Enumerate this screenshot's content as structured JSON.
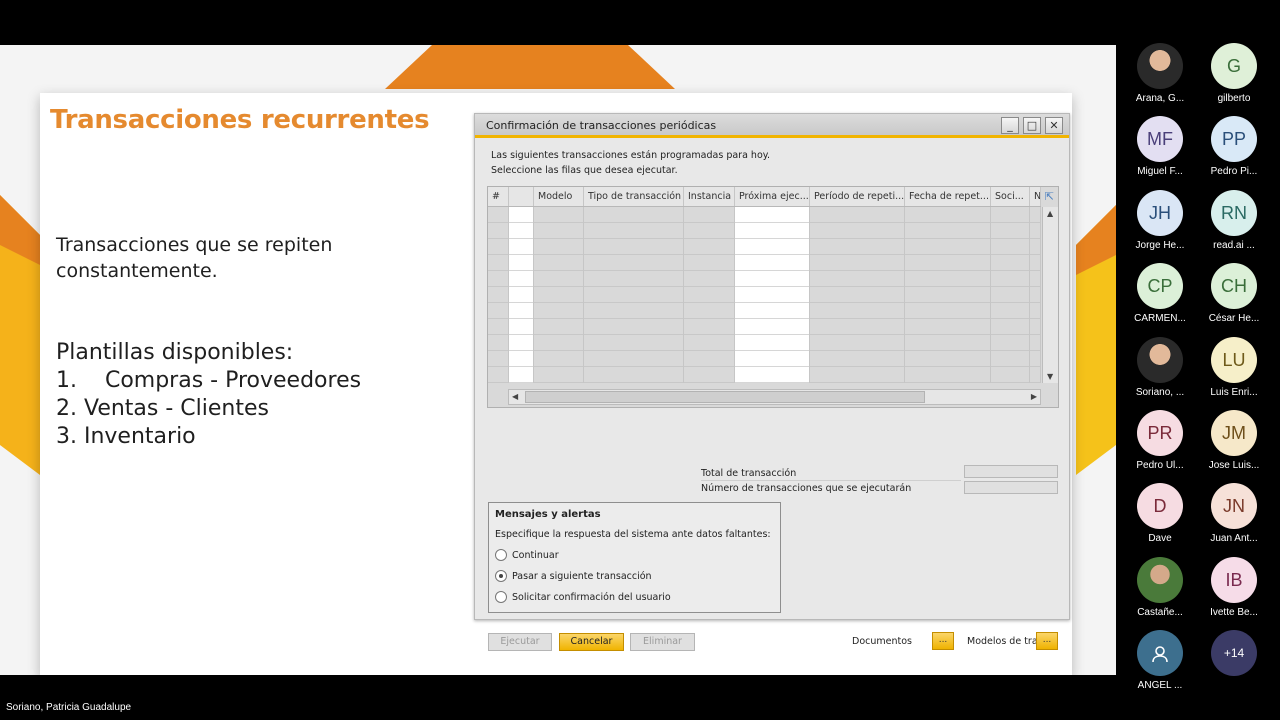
{
  "slide": {
    "title": "Transacciones recurrentes",
    "body1": "Transacciones que se repiten constantemente.",
    "templates_heading": "Plantillas disponibles:",
    "templates": [
      "1.    Compras - Proveedores",
      "2. Ventas - Clientes",
      "3. Inventario"
    ],
    "accent_color": "#e58a2f"
  },
  "dialog": {
    "title": "Confirmación de transacciones periódicas",
    "info_line1": "Las siguientes transacciones están programadas para hoy.",
    "info_line2": "Seleccione las filas que desea ejecutar.",
    "columns": [
      "#",
      "",
      "Modelo",
      "Tipo de transacción",
      "Instancia",
      "Próxima ejec...",
      "Período de repeti...",
      "Fecha de repet...",
      "Soci...",
      "N"
    ],
    "total_label": "Total de transacción",
    "count_label": "Número de transacciones que se ejecutarán",
    "messages": {
      "title": "Mensajes y alertas",
      "subtitle": "Especifique la respuesta del sistema ante datos faltantes:",
      "options": [
        {
          "label": "Continuar",
          "selected": false
        },
        {
          "label": "Pasar a siguiente transacción",
          "selected": true
        },
        {
          "label": "Solicitar confirmación del usuario",
          "selected": false
        }
      ]
    },
    "buttons": {
      "execute": "Ejecutar",
      "cancel": "Cancelar",
      "delete": "Eliminar",
      "documents": "Documentos",
      "models": "Modelos de tra",
      "dots": "..."
    },
    "window_controls": {
      "minimize": "_",
      "maximize": "□",
      "close": "✕"
    }
  },
  "participants": [
    {
      "initials": "",
      "name": "Arana, G...",
      "bg": "photo",
      "fg": "#fff"
    },
    {
      "initials": "G",
      "name": "gilberto",
      "bg": "#dff0d8",
      "fg": "#3a6e3a"
    },
    {
      "initials": "MF",
      "name": "Miguel F...",
      "bg": "#e3dff2",
      "fg": "#4a3f7a"
    },
    {
      "initials": "PP",
      "name": "Pedro Pi...",
      "bg": "#d9e9f7",
      "fg": "#2a4f7a"
    },
    {
      "initials": "JH",
      "name": "Jorge He...",
      "bg": "#dae6f5",
      "fg": "#2a4f7a"
    },
    {
      "initials": "RN",
      "name": "read.ai ...",
      "bg": "#d8efec",
      "fg": "#2a6a63"
    },
    {
      "initials": "CP",
      "name": "CARMEN...",
      "bg": "#dcf0d8",
      "fg": "#3a6e3a"
    },
    {
      "initials": "CH",
      "name": "César He...",
      "bg": "#dcf0d8",
      "fg": "#3a6e3a"
    },
    {
      "initials": "",
      "name": "Soriano, ...",
      "bg": "photo",
      "fg": "#fff"
    },
    {
      "initials": "LU",
      "name": "Luis Enri...",
      "bg": "#f6efc9",
      "fg": "#6e5a1a"
    },
    {
      "initials": "PR",
      "name": "Pedro Ul...",
      "bg": "#f6dce2",
      "fg": "#7a2a3a"
    },
    {
      "initials": "JM",
      "name": "Jose Luis...",
      "bg": "#f6e8c9",
      "fg": "#6e4f1a"
    },
    {
      "initials": "D",
      "name": "Dave",
      "bg": "#f6dce2",
      "fg": "#7a2a3a"
    },
    {
      "initials": "JN",
      "name": "Juan Ant...",
      "bg": "#f6e1d8",
      "fg": "#7a3a2a"
    },
    {
      "initials": "",
      "name": "Castañe...",
      "bg": "photo2",
      "fg": "#fff"
    },
    {
      "initials": "IB",
      "name": "Ivette Be...",
      "bg": "#f6dce8",
      "fg": "#7a2a4f"
    },
    {
      "initials": "",
      "name": "ANGEL ...",
      "bg": "icon",
      "fg": "#fff"
    },
    {
      "initials": "+14",
      "name": "",
      "bg": "#3b3b66",
      "fg": "#fff"
    }
  ],
  "presenter": "Soriano, Patricia Guadalupe"
}
